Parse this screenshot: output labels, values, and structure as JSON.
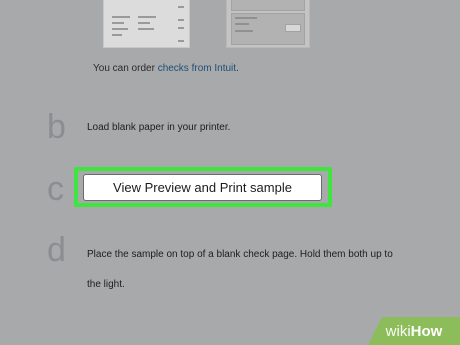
{
  "order_note": {
    "prefix": "You can order ",
    "link": "checks from Intuit",
    "suffix": "."
  },
  "steps": [
    {
      "letter": "b",
      "text": "Load blank paper in your printer."
    },
    {
      "letter": "c",
      "button_label": "View Preview and Print sample"
    },
    {
      "letter": "d",
      "text_line1": "Place the sample on top of a blank check page. Hold them both up to",
      "text_line2": "the light."
    }
  ],
  "watermark": {
    "wiki": "wiki",
    "how": "How"
  },
  "colors": {
    "background": "#a8a9ab",
    "highlight": "#3fe43f",
    "link": "#1f4f74",
    "watermark": "#8dbd5a"
  }
}
